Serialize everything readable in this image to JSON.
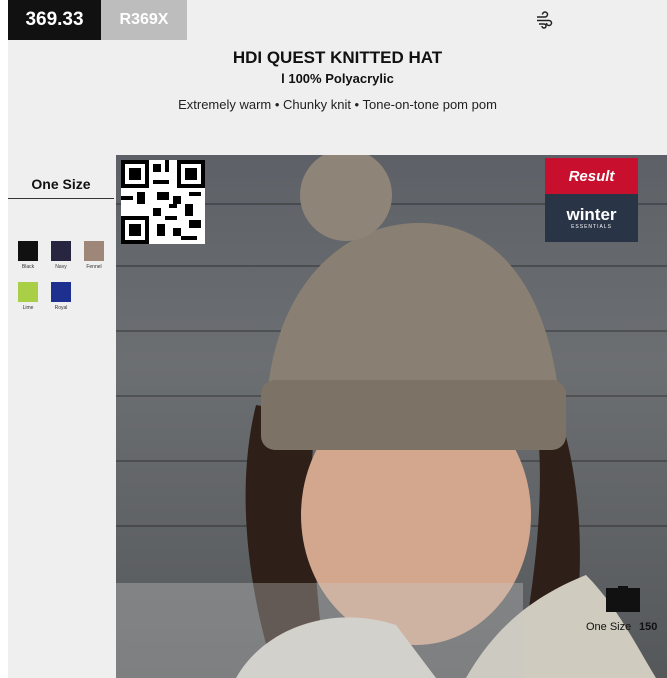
{
  "header": {
    "code": "369.33",
    "sku": "R369X",
    "icon": "wind-icon"
  },
  "product": {
    "title": "HDI QUEST KNITTED HAT",
    "material": "l 100% Polyacrylic",
    "features": "Extremely warm • Chunky knit • Tone-on-tone pom pom"
  },
  "sizes": {
    "label": "One Size"
  },
  "colours": [
    {
      "name": "Black",
      "hex": "#111111"
    },
    {
      "name": "Navy",
      "hex": "#272540"
    },
    {
      "name": "Fennel",
      "hex": "#9e8779"
    },
    {
      "name": "Lime",
      "hex": "#a8cf45"
    },
    {
      "name": "Royal",
      "hex": "#1d2f8f"
    }
  ],
  "brands": {
    "result": "Result",
    "winter": "winter",
    "winter_sub": "ESSENTIALS"
  },
  "pack": {
    "size": "One Size",
    "quantity": "150",
    "icon": "box-icon"
  }
}
